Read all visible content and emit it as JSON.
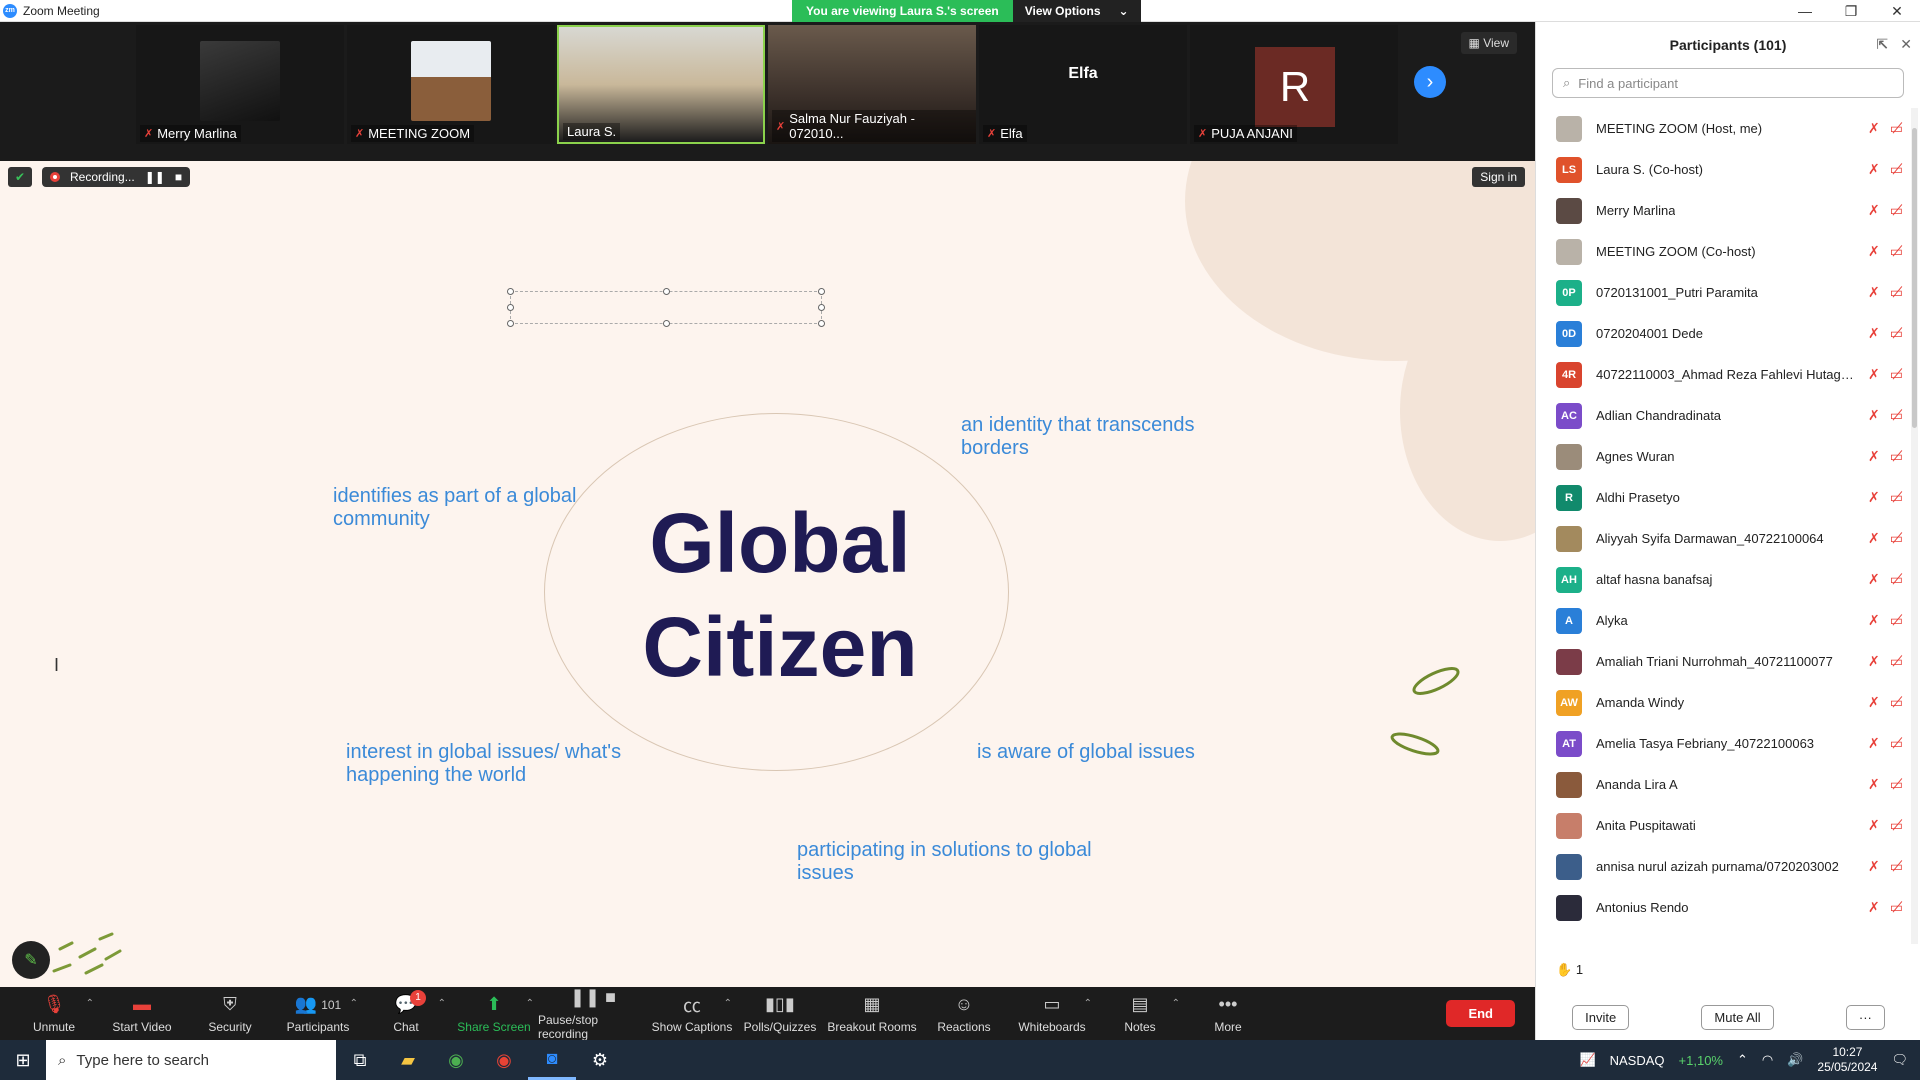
{
  "window": {
    "title": "Zoom Meeting",
    "app_icon": "zm"
  },
  "banner": {
    "viewing": "You are viewing Laura S.'s screen",
    "options": "View Options"
  },
  "video_strip": {
    "view_label": "View",
    "tiles": [
      {
        "name": "Merry Marlina"
      },
      {
        "name": "MEETING ZOOM"
      },
      {
        "name": "Laura S."
      },
      {
        "name": "Salma Nur Fauziyah - 072010..."
      },
      {
        "name": "Elfa",
        "center_text": "Elfa"
      },
      {
        "name": "PUJA ANJANI",
        "initial": "R"
      }
    ]
  },
  "recording": {
    "label": "Recording...",
    "sign_in": "Sign in"
  },
  "slide": {
    "title": "Global Citizen",
    "title_line1": "Global",
    "title_line2": "Citizen",
    "phrases": {
      "p1": "an identity that transcends borders",
      "p2": "identifies as part of a global community",
      "p3": "interest in global issues/ what's happening the world",
      "p4": "is aware of global issues",
      "p5": "participating in solutions to global issues"
    }
  },
  "toolbar": {
    "unmute": "Unmute",
    "start_video": "Start Video",
    "security": "Security",
    "participants": "Participants",
    "participants_count": "101",
    "chat": "Chat",
    "chat_badge": "1",
    "share_screen": "Share Screen",
    "pause_stop": "Pause/stop recording",
    "captions": "Show Captions",
    "polls": "Polls/Quizzes",
    "breakout": "Breakout Rooms",
    "reactions": "Reactions",
    "whiteboards": "Whiteboards",
    "notes": "Notes",
    "more": "More",
    "end": "End"
  },
  "participants_panel": {
    "title": "Participants (101)",
    "search_placeholder": "Find a participant",
    "raised_count": "1",
    "invite": "Invite",
    "mute_all": "Mute All",
    "items": [
      {
        "name": "MEETING ZOOM (Host, me)",
        "initials": "",
        "color": "#b9b2a8"
      },
      {
        "name": "Laura S. (Co-host)",
        "initials": "LS",
        "color": "#e0522b"
      },
      {
        "name": "Merry Marlina",
        "initials": "",
        "color": "#5b4a44"
      },
      {
        "name": "MEETING ZOOM (Co-host)",
        "initials": "",
        "color": "#b9b2a8"
      },
      {
        "name": "0720131001_Putri Paramita",
        "initials": "0P",
        "color": "#1cb089"
      },
      {
        "name": "0720204001 Dede",
        "initials": "0D",
        "color": "#2a7fd8"
      },
      {
        "name": "40722110003_Ahmad Reza Fahlevi Hutagal...",
        "initials": "4R",
        "color": "#d9442e"
      },
      {
        "name": "Adlian Chandradinata",
        "initials": "AC",
        "color": "#7b4cc9"
      },
      {
        "name": "Agnes Wuran",
        "initials": "",
        "color": "#9b8c7a"
      },
      {
        "name": "Aldhi Prasetyo",
        "initials": "R",
        "color": "#118a6c"
      },
      {
        "name": "Aliyyah Syifa Darmawan_40722100064",
        "initials": "",
        "color": "#a38a5e"
      },
      {
        "name": "altaf hasna banafsaj",
        "initials": "AH",
        "color": "#1cb089"
      },
      {
        "name": "Alyka",
        "initials": "A",
        "color": "#2a7fd8"
      },
      {
        "name": "Amaliah Triani Nurrohmah_40721100077",
        "initials": "",
        "color": "#7b3c48"
      },
      {
        "name": "Amanda Windy",
        "initials": "AW",
        "color": "#f0a124"
      },
      {
        "name": "Amelia Tasya Febriany_40722100063",
        "initials": "AT",
        "color": "#7b4cc9"
      },
      {
        "name": "Ananda Lira A",
        "initials": "",
        "color": "#8a5a3c"
      },
      {
        "name": "Anita Puspitawati",
        "initials": "",
        "color": "#c77e6a"
      },
      {
        "name": "annisa nurul azizah purnama/0720203002",
        "initials": "",
        "color": "#3c5e8a"
      },
      {
        "name": "Antonius Rendo",
        "initials": "",
        "color": "#2b2b3a"
      }
    ]
  },
  "taskbar": {
    "search_placeholder": "Type here to search",
    "nasdaq": "NASDAQ",
    "nasdaq_change": "+1,10%",
    "time": "10:27",
    "date": "25/05/2024"
  }
}
